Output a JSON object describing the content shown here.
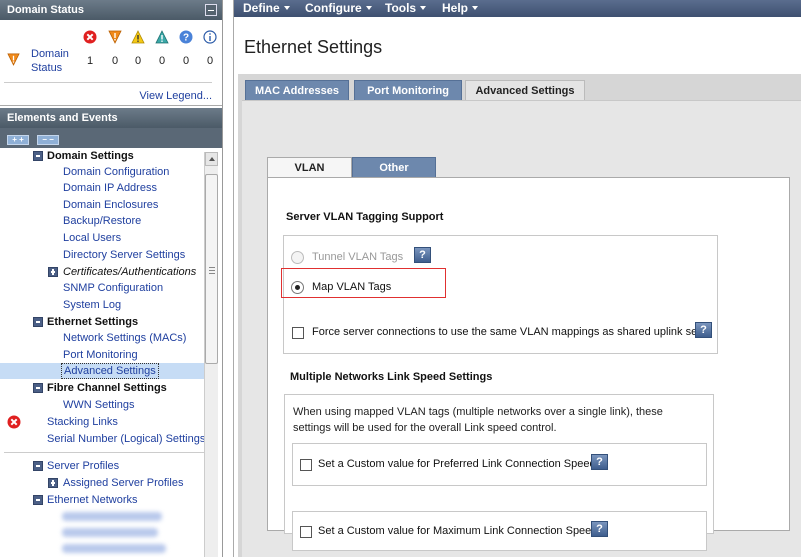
{
  "domain_status": {
    "title": "Domain Status",
    "link_label_line1": "Domain",
    "link_label_line2": "Status",
    "counts": [
      "1",
      "0",
      "0",
      "0",
      "0",
      "0"
    ],
    "icons": [
      "critical-icon",
      "major-icon",
      "warning-icon",
      "minor-icon",
      "unknown-icon",
      "info-icon"
    ],
    "view_legend": "View Legend..."
  },
  "elements_events": {
    "title": "Elements and Events",
    "expand_all": "+ +",
    "collapse_all": "− −"
  },
  "tree": {
    "domain_settings": "Domain Settings",
    "domain_configuration": "Domain Configuration",
    "domain_ip_address": "Domain IP Address",
    "domain_enclosures": "Domain Enclosures",
    "backup_restore": "Backup/Restore",
    "local_users": "Local Users",
    "directory_server_settings": "Directory Server Settings",
    "certificates_authentications": "Certificates/Authentications",
    "snmp_configuration": "SNMP Configuration",
    "system_log": "System Log",
    "ethernet_settings": "Ethernet Settings",
    "network_settings_macs": "Network Settings (MACs)",
    "port_monitoring": "Port Monitoring",
    "advanced_settings": "Advanced Settings",
    "fibre_channel_settings": "Fibre Channel Settings",
    "wwn_settings": "WWN Settings",
    "stacking_links": "Stacking Links",
    "serial_number_settings": "Serial Number (Logical) Settings",
    "server_profiles": "Server Profiles",
    "assigned_server_profiles": "Assigned Server Profiles",
    "ethernet_networks": "Ethernet Networks"
  },
  "menu": {
    "define": "Define",
    "configure": "Configure",
    "tools": "Tools",
    "help": "Help"
  },
  "page_title": "Ethernet Settings",
  "main_tabs": {
    "mac_addresses": "MAC Addresses",
    "port_monitoring": "Port Monitoring",
    "advanced_settings": "Advanced Settings"
  },
  "sub_tabs": {
    "vlan": "VLAN",
    "other": "Other"
  },
  "vlan_tagging": {
    "title": "Server VLAN Tagging Support",
    "tunnel_label": "Tunnel VLAN Tags",
    "map_label": "Map VLAN Tags",
    "force_label": "Force server connections to use the same VLAN mappings as shared uplink sets",
    "help": "?"
  },
  "link_speed": {
    "title": "Multiple Networks Link Speed Settings",
    "desc_line1": "When using mapped VLAN tags (multiple networks over a single link), these",
    "desc_line2": "settings will be used for the overall Link speed control.",
    "preferred_label": "Set a Custom value for Preferred Link Connection Speed",
    "maximum_label": "Set a Custom value for Maximum Link Connection Speed",
    "help": "?"
  },
  "colors": {
    "header_bg": "#4b5a67",
    "menubar_bg": "#4a5d7e",
    "tab_inactive": "#6d88ad",
    "link": "#1f3f9f",
    "highlight": "#e03030"
  }
}
